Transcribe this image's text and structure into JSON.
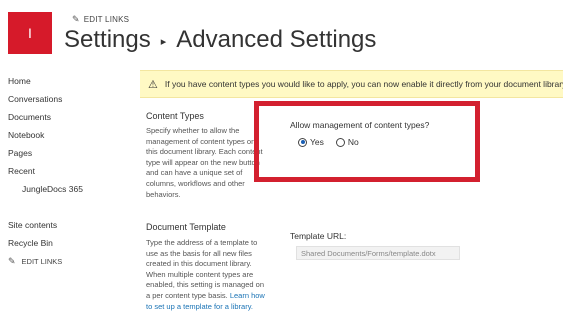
{
  "header": {
    "logo_letter": "I",
    "edit_links": "EDIT LINKS",
    "title_part1": "Settings",
    "title_sep": "▸",
    "title_part2": "Advanced Settings"
  },
  "sidebar": {
    "items": [
      {
        "label": "Home"
      },
      {
        "label": "Conversations"
      },
      {
        "label": "Documents"
      },
      {
        "label": "Notebook"
      },
      {
        "label": "Pages"
      },
      {
        "label": "Recent"
      },
      {
        "label": "JungleDocs 365"
      },
      {
        "label": "Site contents"
      },
      {
        "label": "Recycle Bin"
      }
    ],
    "edit_links": "EDIT LINKS"
  },
  "banner": {
    "icon": "warning-icon",
    "text": "If you have content types you would like to apply, you can now enable it directly from your document library."
  },
  "content_types": {
    "title": "Content Types",
    "description": "Specify whether to allow the management of content types on this document library. Each content type will appear on the new button and can have a unique set of columns, workflows and other behaviors.",
    "question": "Allow management of content types?",
    "options": [
      {
        "label": "Yes",
        "selected": true
      },
      {
        "label": "No",
        "selected": false
      }
    ]
  },
  "document_template": {
    "title": "Document Template",
    "description": "Type the address of a template to use as the basis for all new files created in this document library. When multiple content types are enabled, this setting is managed on a per content type basis.",
    "link_text": "Learn how to set up a template for a library.",
    "url_label": "Template URL:",
    "url_value": "Shared Documents/Forms/template.dotx"
  },
  "colors": {
    "logo": "#d61a2a",
    "highlight_box": "#d3202f",
    "banner_bg": "#fff9c4",
    "link": "#1a73b5"
  }
}
